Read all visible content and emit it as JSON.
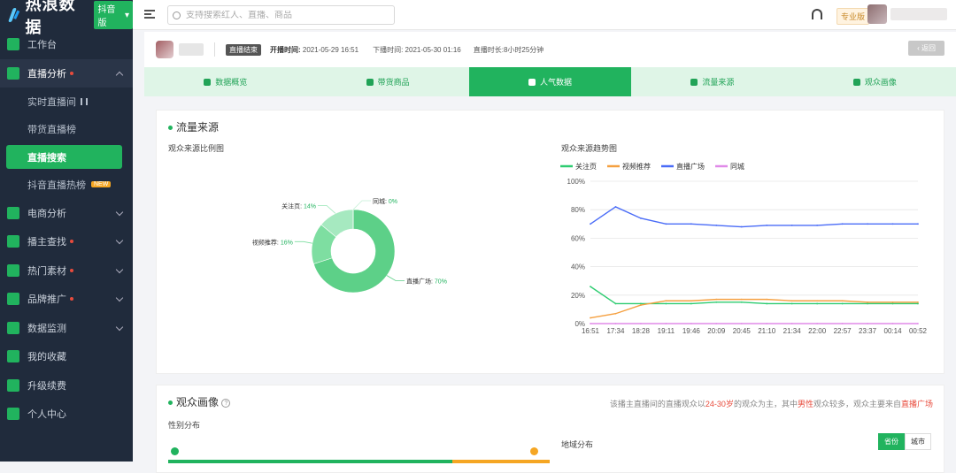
{
  "brand": {
    "name": "热浪数据",
    "edition": "抖音版"
  },
  "sidebar": {
    "items": [
      {
        "label": "工作台",
        "icon": "home-icon"
      },
      {
        "label": "直播分析",
        "icon": "live-icon",
        "dot": true,
        "expanded": true
      },
      {
        "label": "电商分析",
        "icon": "cart-icon"
      },
      {
        "label": "播主查找",
        "icon": "search-user-icon",
        "dot": true
      },
      {
        "label": "热门素材",
        "icon": "video-icon",
        "dot": true
      },
      {
        "label": "品牌推广",
        "icon": "brand-icon",
        "dot": true
      },
      {
        "label": "数据监测",
        "icon": "monitor-icon"
      },
      {
        "label": "我的收藏",
        "icon": "star-icon"
      },
      {
        "label": "升级续费",
        "icon": "upgrade-icon"
      },
      {
        "label": "个人中心",
        "icon": "user-icon"
      }
    ],
    "sub_items": [
      "实时直播间",
      "带货直播榜",
      "直播搜索",
      "抖音直播热榜"
    ],
    "new_badge": "NEW"
  },
  "topbar": {
    "search_placeholder": "支持搜索红人、直播、商品",
    "pro_label": "专业版"
  },
  "live_header": {
    "status": "直播结束",
    "start_label": "开播时间:",
    "start_time": "2021-05-29 16:51",
    "end_label": "下播时间:",
    "end_time": "2021-05-30 01:16",
    "duration_label": "直播时长:",
    "duration": "8小时25分钟",
    "back": "返回"
  },
  "tabs": [
    {
      "label": "数据概览",
      "icon": "pie-icon"
    },
    {
      "label": "带货商品",
      "icon": "bag-icon"
    },
    {
      "label": "人气数据",
      "icon": "fire-icon",
      "active": true
    },
    {
      "label": "流量来源",
      "icon": "drop-icon"
    },
    {
      "label": "观众画像",
      "icon": "portrait-icon"
    }
  ],
  "traffic": {
    "title": "流量来源",
    "pie_title": "观众来源比例图",
    "trend_title": "观众来源趋势图"
  },
  "chart_data": [
    {
      "type": "pie",
      "title": "观众来源比例图",
      "labels": [
        "直播广场",
        "视频推荐",
        "关注页",
        "同城"
      ],
      "values": [
        70,
        16,
        14,
        0
      ],
      "value_labels": [
        "70%",
        "16%",
        "14%",
        "0%"
      ],
      "colors": [
        "#5dd088",
        "#7edea1",
        "#a6e9c0",
        "#c4f0d5"
      ]
    },
    {
      "type": "line",
      "title": "观众来源趋势图",
      "x": [
        "16:51",
        "17:34",
        "18:28",
        "19:11",
        "19:46",
        "20:09",
        "20:45",
        "21:10",
        "21:34",
        "22:00",
        "22:57",
        "23:37",
        "00:14",
        "00:52"
      ],
      "ylim": [
        0,
        100
      ],
      "yticks": [
        "0%",
        "20%",
        "40%",
        "60%",
        "80%",
        "100%"
      ],
      "legend_position": "top-left",
      "series": [
        {
          "name": "关注页",
          "color": "#2ecc71",
          "values": [
            26,
            14,
            14,
            14,
            14,
            15,
            15,
            14,
            14,
            14,
            14,
            14,
            14,
            14
          ]
        },
        {
          "name": "视频推荐",
          "color": "#f5a040",
          "values": [
            4,
            7,
            13,
            16,
            16,
            17,
            17,
            17,
            16,
            16,
            16,
            15,
            15,
            15
          ]
        },
        {
          "name": "直播广场",
          "color": "#4a6cf7",
          "values": [
            70,
            82,
            74,
            70,
            70,
            69,
            68,
            69,
            69,
            69,
            70,
            70,
            70,
            70
          ]
        },
        {
          "name": "同城",
          "color": "#e08ae8",
          "values": [
            0,
            0,
            0,
            0,
            0,
            0,
            0,
            0,
            0,
            0,
            0,
            0,
            0,
            0
          ]
        }
      ]
    }
  ],
  "audience": {
    "title": "观众画像",
    "gender_title": "性别分布",
    "geo_title": "地域分布",
    "geo_options": [
      "省份",
      "城市"
    ],
    "notice_pre": "该播主直播间的直播观众以",
    "notice_age": "24-30岁",
    "notice_mid": "的观众为主，其中",
    "notice_gender": "男性",
    "notice_mid2": "观众较多，观众主要来自",
    "notice_src": "直播广场"
  }
}
